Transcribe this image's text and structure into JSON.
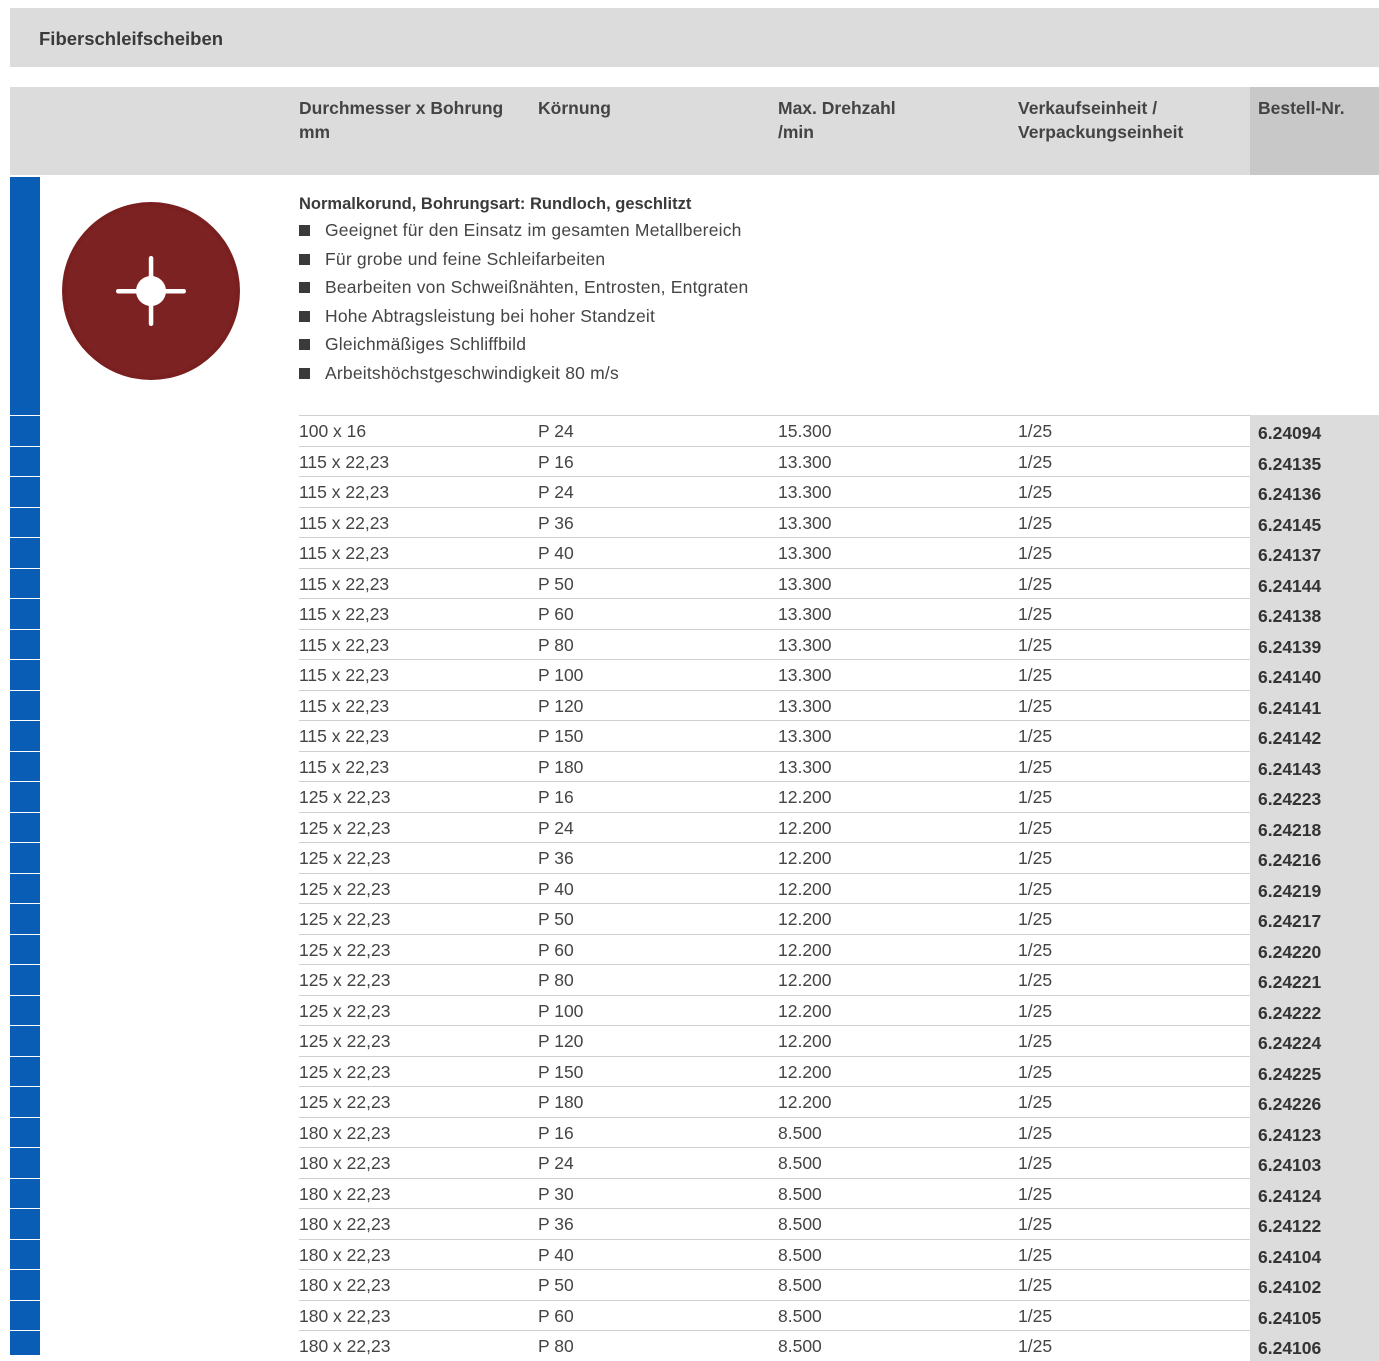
{
  "section_title": "Fiberschleifscheiben",
  "columns": {
    "diameter": "Durchmesser x Bohrung\nmm",
    "grit": "Körnung",
    "rpm": "Max. Drehzahl\n/min",
    "unit": "Verkaufseinheit /\nVerpackungseinheit",
    "order": "Bestell-Nr."
  },
  "product": {
    "title": "Normalkorund, Bohrungsart: Rundloch, geschlitzt",
    "features": [
      "Geeignet für den Einsatz im gesamten Metallbereich",
      "Für grobe und feine Schleifarbeiten",
      "Bearbeiten von Schweißnähten, Entrosten, Entgraten",
      "Hohe Abtragsleistung bei hoher Standzeit",
      "Gleichmäßiges Schliffbild",
      "Arbeitshöchstgeschwindigkeit 80 m/s"
    ],
    "image_icon": "fiber-disc-icon",
    "disc_color": "#7a1f1f"
  },
  "colors": {
    "accent": "#0a5db5",
    "header_bg": "#dcdcdc"
  },
  "rows": [
    {
      "size": "100 x 16",
      "grit": "P 24",
      "rpm": "15.300",
      "unit": "1/25",
      "order": "6.24094"
    },
    {
      "size": "115 x 22,23",
      "grit": "P 16",
      "rpm": "13.300",
      "unit": "1/25",
      "order": "6.24135"
    },
    {
      "size": "115 x 22,23",
      "grit": "P 24",
      "rpm": "13.300",
      "unit": "1/25",
      "order": "6.24136"
    },
    {
      "size": "115 x 22,23",
      "grit": "P 36",
      "rpm": "13.300",
      "unit": "1/25",
      "order": "6.24145"
    },
    {
      "size": "115 x 22,23",
      "grit": "P 40",
      "rpm": "13.300",
      "unit": "1/25",
      "order": "6.24137"
    },
    {
      "size": "115 x 22,23",
      "grit": "P 50",
      "rpm": "13.300",
      "unit": "1/25",
      "order": "6.24144"
    },
    {
      "size": "115 x 22,23",
      "grit": "P 60",
      "rpm": "13.300",
      "unit": "1/25",
      "order": "6.24138"
    },
    {
      "size": "115 x 22,23",
      "grit": "P 80",
      "rpm": "13.300",
      "unit": "1/25",
      "order": "6.24139"
    },
    {
      "size": "115 x 22,23",
      "grit": "P 100",
      "rpm": "13.300",
      "unit": "1/25",
      "order": "6.24140"
    },
    {
      "size": "115 x 22,23",
      "grit": "P 120",
      "rpm": "13.300",
      "unit": "1/25",
      "order": "6.24141"
    },
    {
      "size": "115 x 22,23",
      "grit": "P 150",
      "rpm": "13.300",
      "unit": "1/25",
      "order": "6.24142"
    },
    {
      "size": "115 x 22,23",
      "grit": "P 180",
      "rpm": "13.300",
      "unit": "1/25",
      "order": "6.24143"
    },
    {
      "size": "125 x 22,23",
      "grit": "P 16",
      "rpm": "12.200",
      "unit": "1/25",
      "order": "6.24223"
    },
    {
      "size": "125 x 22,23",
      "grit": "P 24",
      "rpm": "12.200",
      "unit": "1/25",
      "order": "6.24218"
    },
    {
      "size": "125 x 22,23",
      "grit": "P 36",
      "rpm": "12.200",
      "unit": "1/25",
      "order": "6.24216"
    },
    {
      "size": "125 x 22,23",
      "grit": "P 40",
      "rpm": "12.200",
      "unit": "1/25",
      "order": "6.24219"
    },
    {
      "size": "125 x 22,23",
      "grit": "P 50",
      "rpm": "12.200",
      "unit": "1/25",
      "order": "6.24217"
    },
    {
      "size": "125 x 22,23",
      "grit": "P 60",
      "rpm": "12.200",
      "unit": "1/25",
      "order": "6.24220"
    },
    {
      "size": "125 x 22,23",
      "grit": "P 80",
      "rpm": "12.200",
      "unit": "1/25",
      "order": "6.24221"
    },
    {
      "size": "125 x 22,23",
      "grit": "P 100",
      "rpm": "12.200",
      "unit": "1/25",
      "order": "6.24222"
    },
    {
      "size": "125 x 22,23",
      "grit": "P 120",
      "rpm": "12.200",
      "unit": "1/25",
      "order": "6.24224"
    },
    {
      "size": "125 x 22,23",
      "grit": "P 150",
      "rpm": "12.200",
      "unit": "1/25",
      "order": "6.24225"
    },
    {
      "size": "125 x 22,23",
      "grit": "P 180",
      "rpm": "12.200",
      "unit": "1/25",
      "order": "6.24226"
    },
    {
      "size": "180 x 22,23",
      "grit": "P 16",
      "rpm": "8.500",
      "unit": "1/25",
      "order": "6.24123"
    },
    {
      "size": "180 x 22,23",
      "grit": "P 24",
      "rpm": "8.500",
      "unit": "1/25",
      "order": "6.24103"
    },
    {
      "size": "180 x 22,23",
      "grit": "P 30",
      "rpm": "8.500",
      "unit": "1/25",
      "order": "6.24124"
    },
    {
      "size": "180 x 22,23",
      "grit": "P 36",
      "rpm": "8.500",
      "unit": "1/25",
      "order": "6.24122"
    },
    {
      "size": "180 x 22,23",
      "grit": "P 40",
      "rpm": "8.500",
      "unit": "1/25",
      "order": "6.24104"
    },
    {
      "size": "180 x 22,23",
      "grit": "P 50",
      "rpm": "8.500",
      "unit": "1/25",
      "order": "6.24102"
    },
    {
      "size": "180 x 22,23",
      "grit": "P 60",
      "rpm": "8.500",
      "unit": "1/25",
      "order": "6.24105"
    },
    {
      "size": "180 x 22,23",
      "grit": "P 80",
      "rpm": "8.500",
      "unit": "1/25",
      "order": "6.24106"
    }
  ]
}
